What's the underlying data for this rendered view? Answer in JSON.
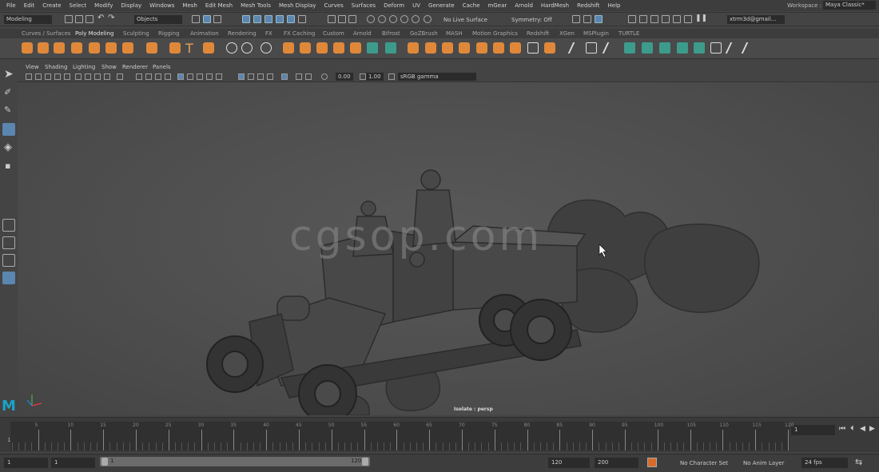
{
  "menu": [
    "File",
    "Edit",
    "Create",
    "Select",
    "Modify",
    "Display",
    "Windows",
    "Mesh",
    "Edit Mesh",
    "Mesh Tools",
    "Mesh Display",
    "Curves",
    "Surfaces",
    "Deform",
    "UV",
    "Generate",
    "Cache",
    "mGear",
    "Arnold",
    "HardMesh",
    "Redshift",
    "Help"
  ],
  "workspace": {
    "label": "Workspace :",
    "value": "Maya Classic*"
  },
  "status": {
    "mode": "Modeling",
    "objects": "Objects",
    "live_surface": "No Live Surface",
    "symmetry": "Symmetry: Off",
    "user": "xtrm3d@gmail..."
  },
  "shelf_tabs": [
    "Curves / Surfaces",
    "Poly Modeling",
    "Sculpting",
    "Rigging",
    "Animation",
    "Rendering",
    "FX",
    "FX Caching",
    "Custom",
    "Arnold",
    "Bifrost",
    "GoZBrush",
    "MASH",
    "Motion Graphics",
    "Redshift",
    "XGen",
    "MSPlugin",
    "TURTLE"
  ],
  "active_shelf_tab": "Poly Modeling",
  "panel_menu": [
    "View",
    "Shading",
    "Lighting",
    "Show",
    "Renderer",
    "Panels"
  ],
  "panel_fields": {
    "exposure": "0.00",
    "gamma": "1.00",
    "colorspace": "sRGB gamma"
  },
  "viewport": {
    "watermark": "cgsop.com",
    "camera_label": "Isolate : persp"
  },
  "logo": "M",
  "timeline": {
    "ticks": [
      "5",
      "10",
      "15",
      "20",
      "25",
      "30",
      "35",
      "40",
      "45",
      "50",
      "55",
      "60",
      "65",
      "70",
      "75",
      "80",
      "85",
      "90",
      "95",
      "100",
      "105",
      "110",
      "115",
      "120"
    ],
    "start_tick": "1",
    "current_frame": "1"
  },
  "range": {
    "start": "1",
    "playback_start": "1",
    "slider_start": "1",
    "slider_end": "120",
    "playback_end": "120",
    "end": "200",
    "character_set": "No Character Set",
    "anim_layer": "No Anim Layer",
    "fps": "24 fps"
  },
  "colors": {
    "accent": "#e0883a",
    "teal": "#3d9b8c",
    "select": "#5a86b0",
    "logo": "#1aa3c6"
  }
}
